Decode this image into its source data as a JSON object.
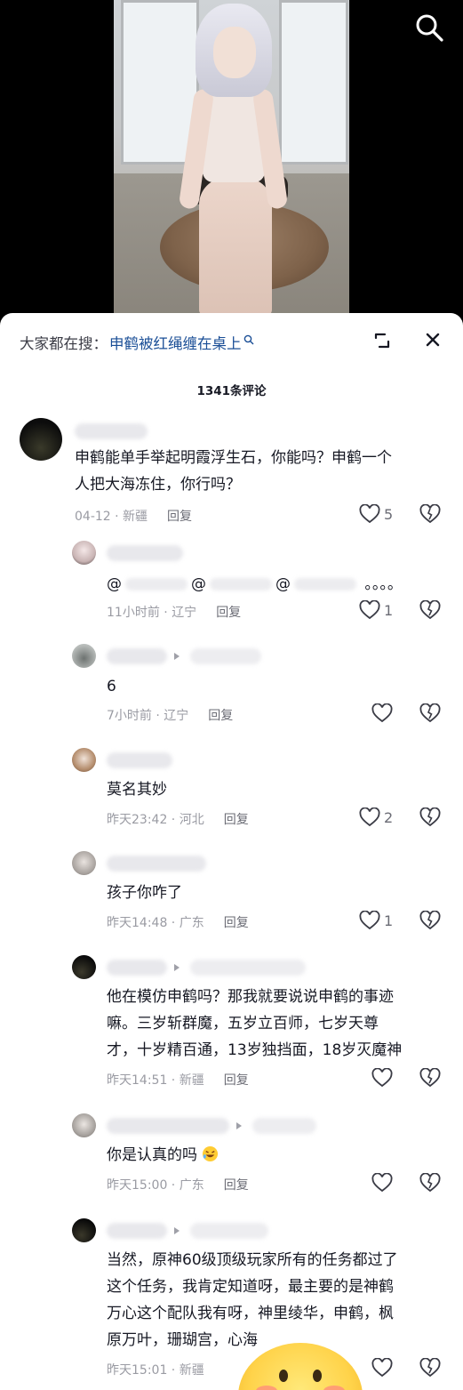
{
  "suggestion": {
    "prefix": "大家都在搜：",
    "query": "申鹤被红绳缠在桌上"
  },
  "comment_count": "1341条评论",
  "comments": [
    {
      "text_lines": [
        "申鹤能单手举起明霞浮生石，你能吗？申鹤一个",
        "人把大海冻住，你行吗？"
      ],
      "time": "04-12",
      "region": "新疆",
      "reply_label": "回复",
      "likes": "5"
    },
    {
      "mentions": [
        "@",
        "@",
        "@"
      ],
      "dots": "。。。。",
      "time": "11小时前",
      "region": "辽宁",
      "reply_label": "回复",
      "likes": "1"
    },
    {
      "text_lines": [
        "6"
      ],
      "time": "7小时前",
      "region": "辽宁",
      "reply_label": "回复",
      "likes": ""
    },
    {
      "text_lines": [
        "莫名其妙"
      ],
      "time": "昨天23:42",
      "region": "河北",
      "reply_label": "回复",
      "likes": "2"
    },
    {
      "text_lines": [
        "孩子你咋了"
      ],
      "time": "昨天14:48",
      "region": "广东",
      "reply_label": "回复",
      "likes": "1"
    },
    {
      "text_lines": [
        "他在模仿申鹤吗？那我就要说说申鹤的事迹",
        "嘛。三岁斩群魔，五岁立百师，七岁天尊",
        "才，十岁精百通，13岁独挡面，18岁灭魔神"
      ],
      "time": "昨天14:51",
      "region": "新疆",
      "reply_label": "回复",
      "likes": ""
    },
    {
      "text_lines": [
        "你是认真的吗"
      ],
      "time": "昨天15:00",
      "region": "广东",
      "reply_label": "回复",
      "likes": ""
    },
    {
      "text_lines": [
        "当然，原神60级顶级玩家所有的任务都过了",
        "这个任务，我肯定知道呀，最主要的是神鹤",
        "万心这个配队我有呀，神里绫华，申鹤，枫",
        "原万叶，珊瑚宫，心海"
      ],
      "time": "昨天15:01",
      "region": "新疆",
      "reply_label": "",
      "likes": ""
    }
  ],
  "icons": {
    "search": "search-icon",
    "shrink": "shrink-icon",
    "close": "close-icon",
    "like": "heart-icon",
    "dislike": "broken-heart-icon",
    "emoji": "laughing-emoji-icon"
  },
  "colors": {
    "link_blue": "#1a4e96",
    "meta_gray": "#9a9ba3",
    "text": "#161823"
  }
}
